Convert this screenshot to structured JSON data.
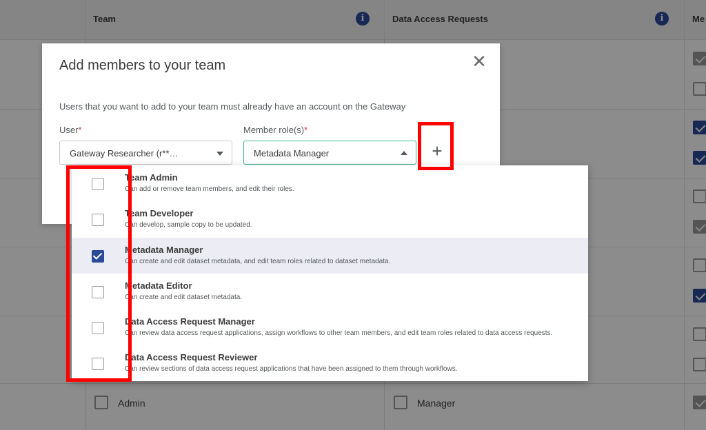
{
  "background": {
    "columns": [
      {
        "title": "Team"
      },
      {
        "title": "Data Access Requests"
      },
      {
        "title": "Me"
      }
    ],
    "bottom_row": {
      "team_label": "Admin",
      "dar_label": "Manager"
    }
  },
  "modal": {
    "title": "Add members to your team",
    "description": "Users that you want to add to your team must already have an account on the Gateway",
    "user_label": "User",
    "user_value": "Gateway Researcher (r**…",
    "role_label": "Member role(s)",
    "role_value": "Metadata Manager",
    "required_mark": "*",
    "close_icon": "close-icon",
    "add_icon": "plus-icon"
  },
  "dropdown": {
    "options": [
      {
        "title": "Team Admin",
        "description": "Can add or remove team members, and edit their roles.",
        "checked": false
      },
      {
        "title": "Team Developer",
        "description": "Can develop, sample copy to be updated.",
        "checked": false
      },
      {
        "title": "Metadata Manager",
        "description": "Can create and edit dataset metadata, and edit team roles related to dataset metadata.",
        "checked": true
      },
      {
        "title": "Metadata Editor",
        "description": "Can create and edit dataset metadata.",
        "checked": false
      },
      {
        "title": "Data Access Request Manager",
        "description": "Can review data access request applications, assign workflows to other team members, and edit team roles related to data access requests.",
        "checked": false
      },
      {
        "title": "Data Access Request Reviewer",
        "description": "Can review sections of data access request applications that have been assigned to them through workflows.",
        "checked": false
      }
    ]
  },
  "colors": {
    "accent": "#2c4a9a",
    "annotation": "#ff0000",
    "focus_border": "#3db28c"
  }
}
